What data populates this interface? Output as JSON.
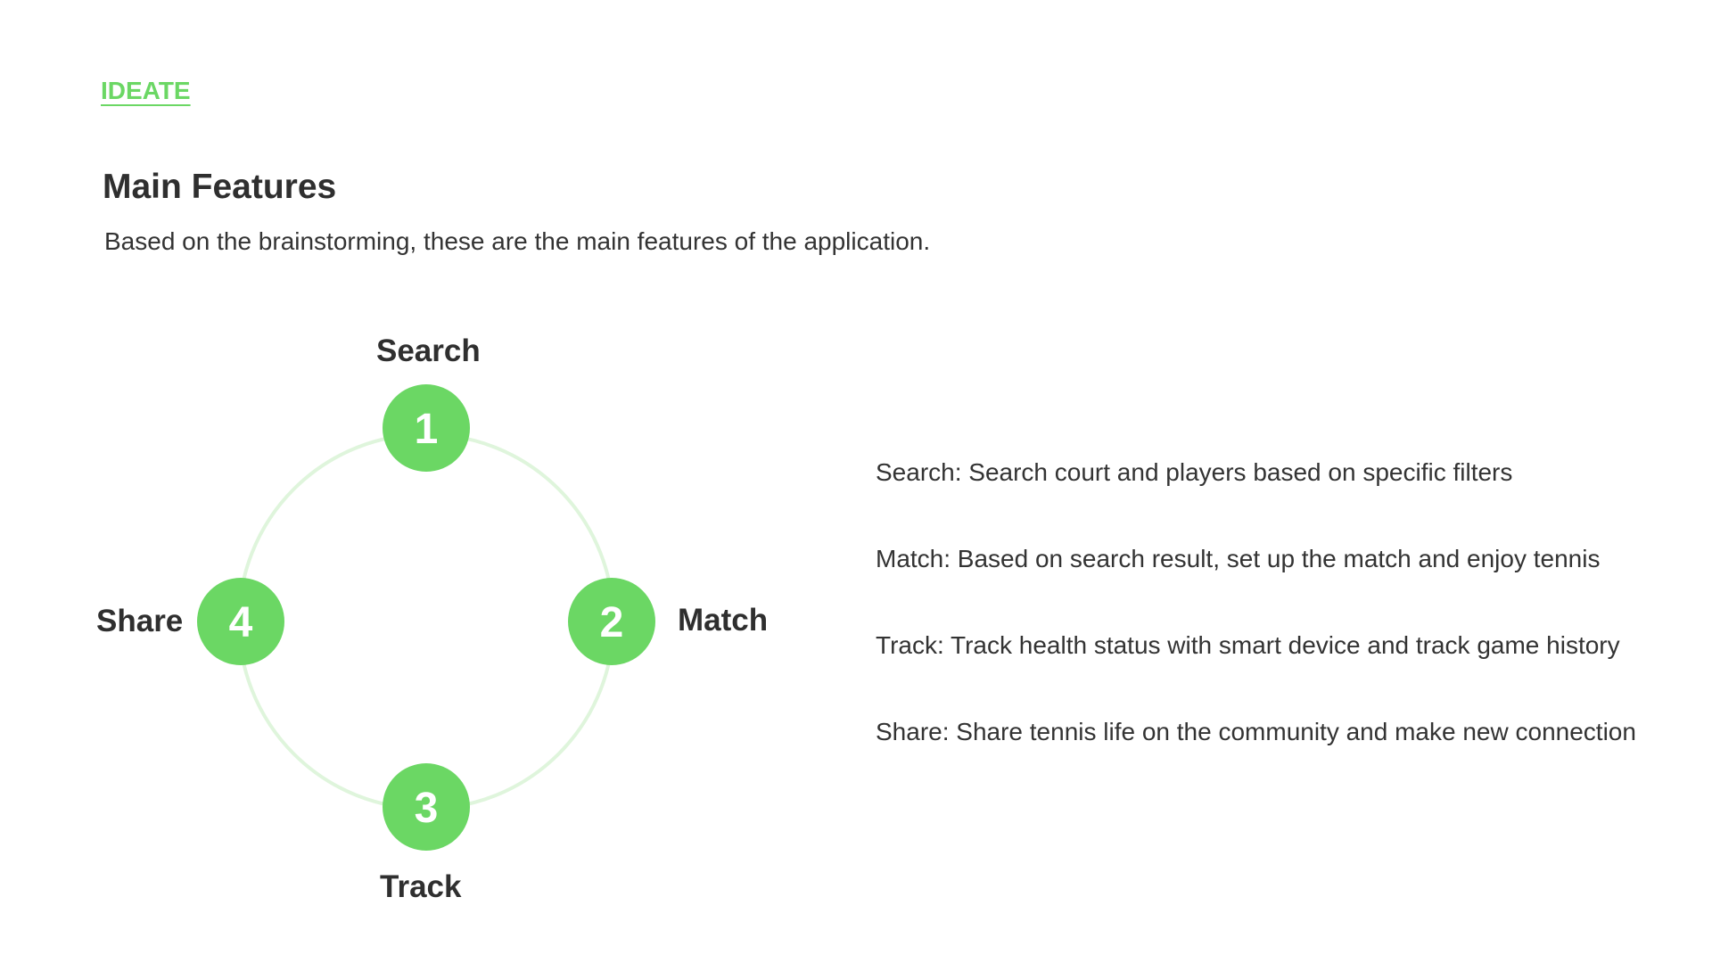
{
  "colors": {
    "accent": "#6bd764",
    "ring": "#dff5dc",
    "text_dark": "#2f2f2f"
  },
  "header": {
    "section_tag": "IDEATE",
    "title": "Main Features",
    "subtitle": "Based on the brainstorming, these are the main features of the application."
  },
  "diagram": {
    "nodes": [
      {
        "number": "1",
        "label": "Search"
      },
      {
        "number": "2",
        "label": "Match"
      },
      {
        "number": "3",
        "label": "Track"
      },
      {
        "number": "4",
        "label": "Share"
      }
    ]
  },
  "features": [
    {
      "text": "Search: Search court and players based on specific filters"
    },
    {
      "text": "Match: Based on search result, set up the match and enjoy tennis"
    },
    {
      "text": "Track: Track health status with smart device and track game history"
    },
    {
      "text": "Share: Share tennis life on the community and make new connection"
    }
  ]
}
